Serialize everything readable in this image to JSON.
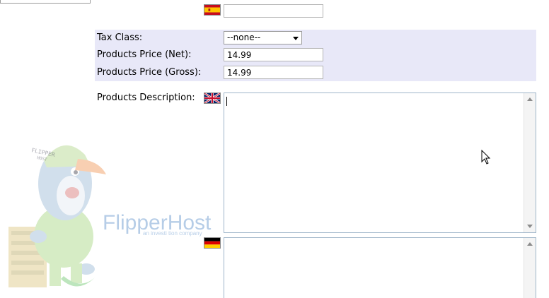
{
  "flags": {
    "es": "spain-flag-icon",
    "en": "uk-flag-icon",
    "de": "germany-flag-icon"
  },
  "form": {
    "product_name_es_value": "",
    "tax_class": {
      "label": "Tax Class:",
      "selected": "--none--"
    },
    "price_net": {
      "label": "Products Price (Net):",
      "value": "14.99"
    },
    "price_gross": {
      "label": "Products Price (Gross):",
      "value": "14.99"
    },
    "description": {
      "label": "Products Description:",
      "value_en": "",
      "value_de": ""
    }
  },
  "watermark": {
    "brand": "FlipperHost",
    "tagline": "an investi tion company",
    "cap_text_1": "FLIPPER",
    "cap_text_2": "HOST"
  },
  "colors": {
    "price_band": "#e8e8f8",
    "brand_blue": "#4a84c4",
    "brand_orange": "#e8701c"
  },
  "icons": {
    "cursor": "mouse-pointer-icon"
  }
}
